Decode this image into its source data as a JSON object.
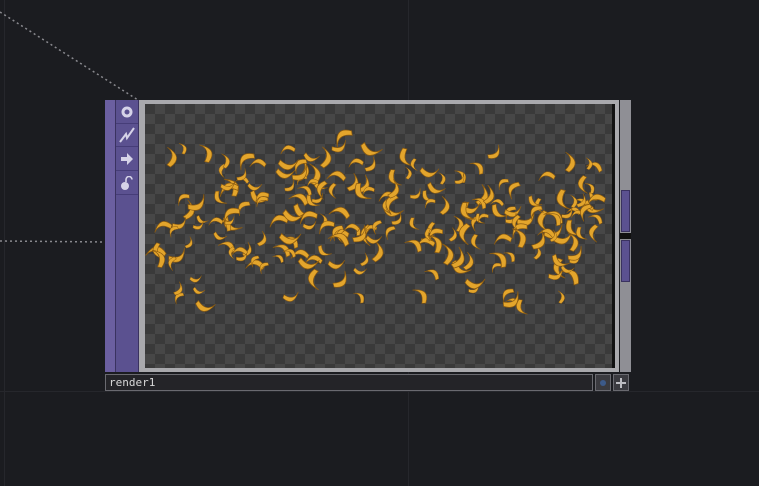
{
  "node": {
    "name": "render1",
    "type": "Render TOP",
    "viewer_content": "bananas"
  },
  "side_icons": [
    {
      "name": "viewer-toggle-icon"
    },
    {
      "name": "cook-lightning-icon"
    },
    {
      "name": "bypass-arrow-icon"
    },
    {
      "name": "lock-icon"
    }
  ],
  "colors": {
    "background": "#1b1c20",
    "node_purple": "#5b5190",
    "banana_yellow": "#e3a52c",
    "checker_dark": "#3a3a3a",
    "checker_light": "#474747"
  }
}
